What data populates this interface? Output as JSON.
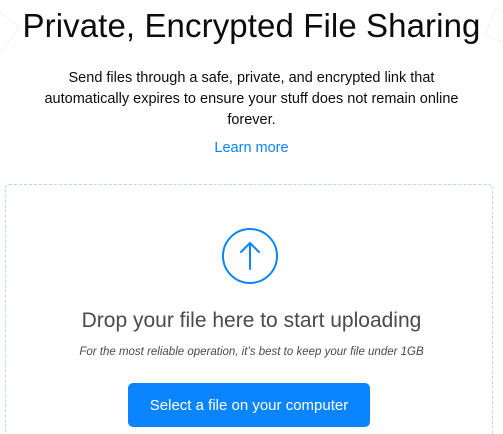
{
  "header": {
    "title": "Private, Encrypted File Sharing",
    "description": "Send files through a safe, private, and encrypted link that automatically expires to ensure your stuff does not remain online forever.",
    "learn_more": "Learn more"
  },
  "upload": {
    "icon": "upload-arrow-icon",
    "drop_message": "Drop your file here to start uploading",
    "hint": "For the most reliable operation, it’s best to keep your file under 1GB",
    "select_button": "Select a file on your computer"
  },
  "colors": {
    "accent": "#0a84ff",
    "text": "#0c0c0d",
    "muted": "#4a4a4f",
    "dropzone_border": "#b7d7f0"
  }
}
